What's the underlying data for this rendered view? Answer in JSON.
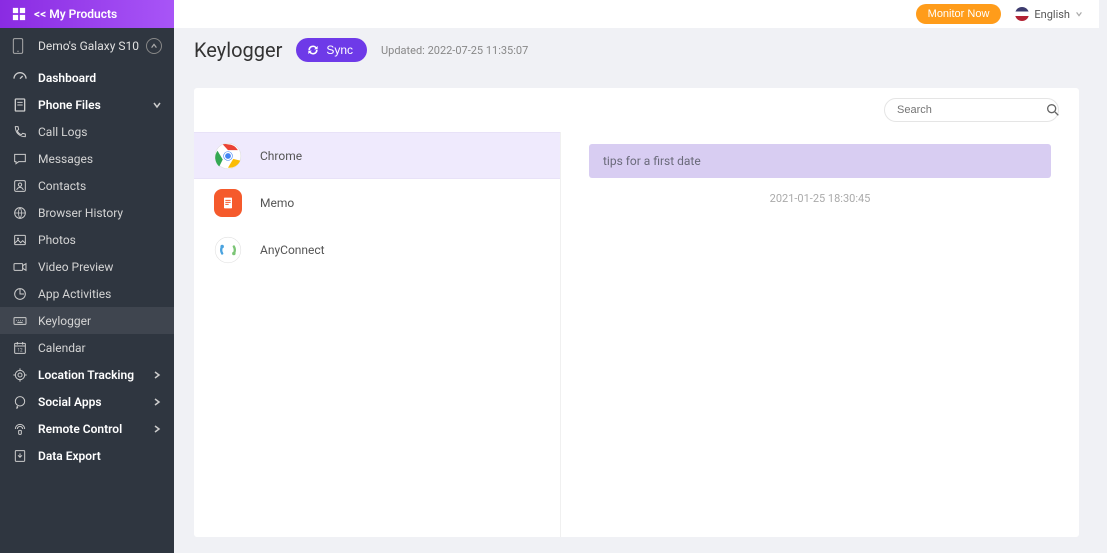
{
  "topbar": {
    "monitor_label": "Monitor Now",
    "language_label": "English"
  },
  "sidebar": {
    "products_label": "<< My Products",
    "device_name": "Demo's Galaxy S10",
    "items": [
      {
        "label": "Dashboard",
        "bold": true
      },
      {
        "label": "Phone Files",
        "bold": true,
        "expandable": true
      },
      {
        "label": "Call Logs"
      },
      {
        "label": "Messages"
      },
      {
        "label": "Contacts"
      },
      {
        "label": "Browser History"
      },
      {
        "label": "Photos"
      },
      {
        "label": "Video Preview"
      },
      {
        "label": "App Activities"
      },
      {
        "label": "Keylogger",
        "active": true
      },
      {
        "label": "Calendar"
      },
      {
        "label": "Location Tracking",
        "bold": true,
        "expandable": true
      },
      {
        "label": "Social Apps",
        "bold": true,
        "expandable": true
      },
      {
        "label": "Remote Control",
        "bold": true,
        "expandable": true
      },
      {
        "label": "Data Export",
        "bold": true
      }
    ]
  },
  "page": {
    "title": "Keylogger",
    "sync_label": "Sync",
    "updated_prefix": "Updated:",
    "updated_time": "2022-07-25 11:35:07"
  },
  "search": {
    "placeholder": "Search"
  },
  "apps": [
    {
      "name": "Chrome",
      "selected": true
    },
    {
      "name": "Memo"
    },
    {
      "name": "AnyConnect"
    }
  ],
  "log": {
    "entry_text": "tips for a first date",
    "timestamp": "2021-01-25 18:30:45"
  }
}
